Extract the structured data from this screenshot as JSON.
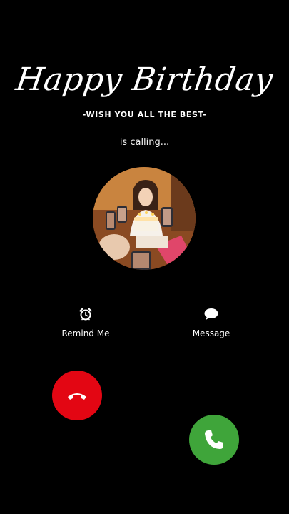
{
  "greeting": {
    "title": "Happy Birthday",
    "subtitle": "-WISH YOU ALL THE BEST-"
  },
  "call": {
    "status": "is calling..."
  },
  "actions": {
    "remind_label": "Remind Me",
    "message_label": "Message"
  },
  "icons": {
    "remind": "alarm-clock-icon",
    "message": "chat-bubble-icon",
    "decline": "phone-hangup-icon",
    "accept": "phone-icon"
  },
  "colors": {
    "background": "#000000",
    "decline": "#e30613",
    "accept": "#3fa53a"
  }
}
